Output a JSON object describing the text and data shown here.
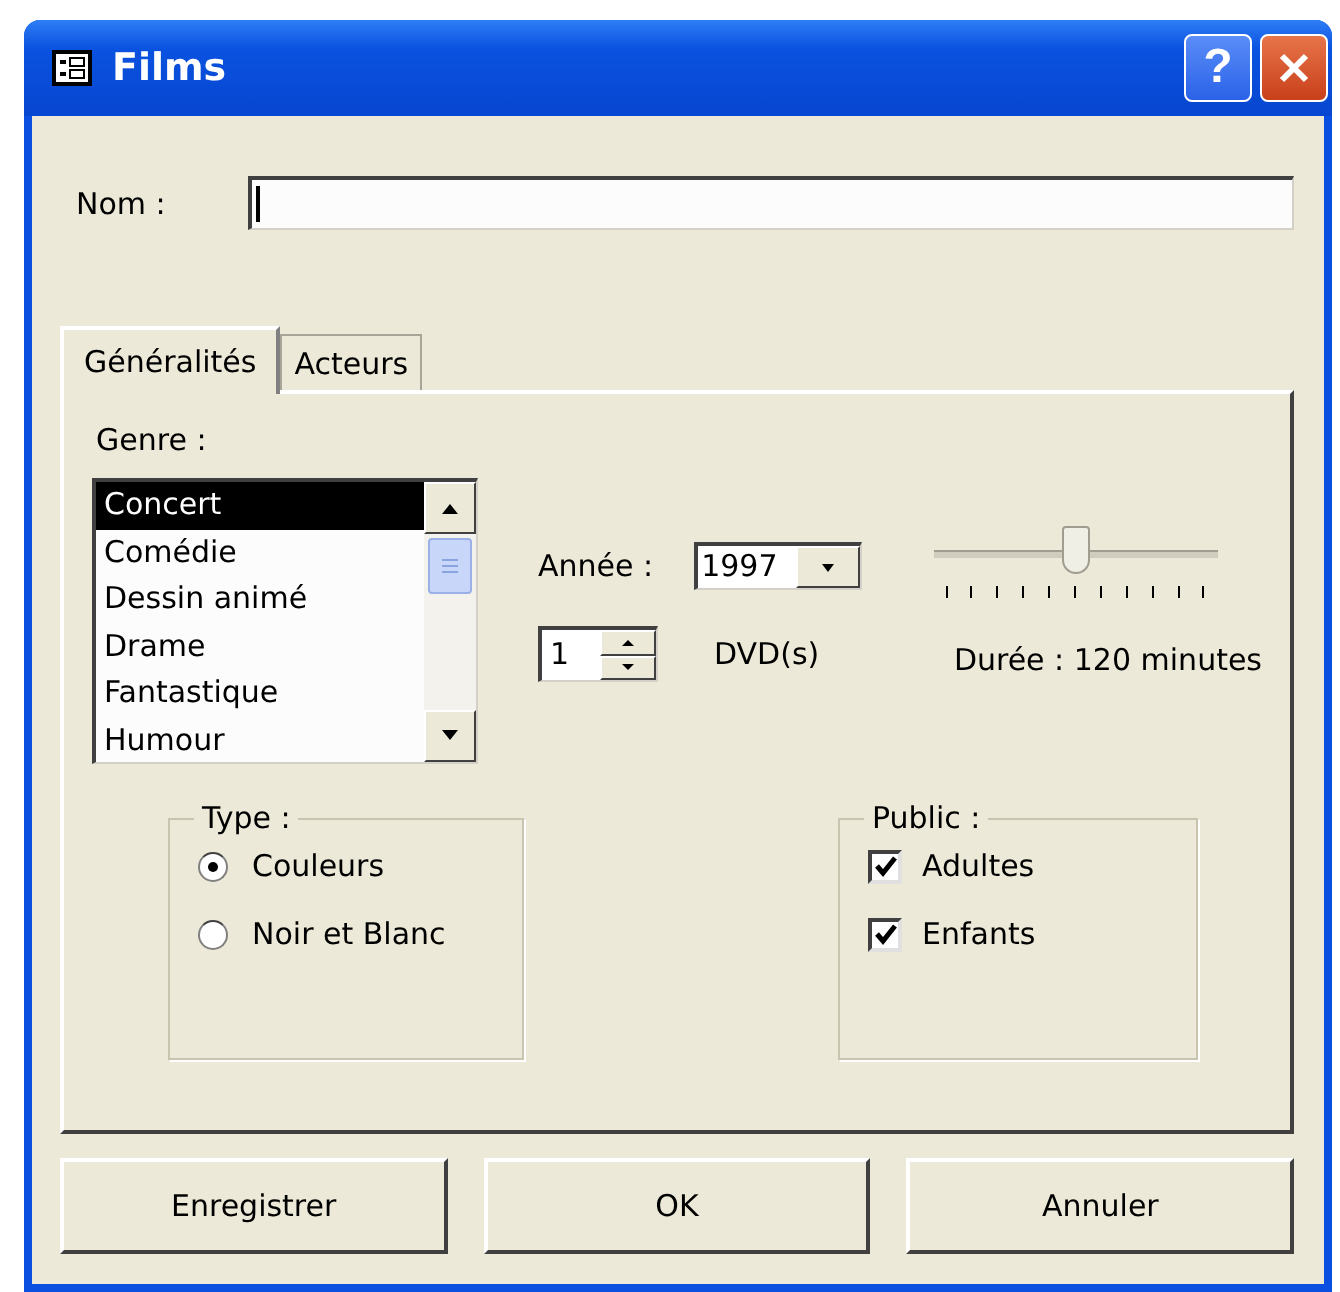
{
  "window": {
    "title": "Films",
    "help_button": "?"
  },
  "name_field": {
    "label": "Nom :"
  },
  "tabs": [
    {
      "label": "Généralités",
      "selected": true
    },
    {
      "label": "Acteurs",
      "selected": false
    }
  ],
  "genre": {
    "label": "Genre :",
    "items": [
      {
        "label": "Concert",
        "selected": true
      },
      {
        "label": "Comédie",
        "selected": false
      },
      {
        "label": "Dessin animé",
        "selected": false
      },
      {
        "label": "Drame",
        "selected": false
      },
      {
        "label": "Fantastique",
        "selected": false
      },
      {
        "label": "Humour",
        "selected": false
      }
    ]
  },
  "year": {
    "label": "Année :",
    "value": "1997"
  },
  "dvd": {
    "value": "1",
    "unit": "DVD(s)"
  },
  "duration": {
    "level": 0.5,
    "label": "Durée : 120 minutes"
  },
  "type_group": {
    "title": "Type :",
    "options": [
      {
        "label": "Couleurs",
        "selected": true
      },
      {
        "label": "Noir et Blanc",
        "selected": false
      }
    ]
  },
  "public_group": {
    "title": "Public :",
    "options": [
      {
        "label": "Adultes",
        "checked": true
      },
      {
        "label": "Enfants",
        "checked": true
      }
    ]
  },
  "buttons": [
    "Enregistrer",
    "OK",
    "Annuler"
  ]
}
